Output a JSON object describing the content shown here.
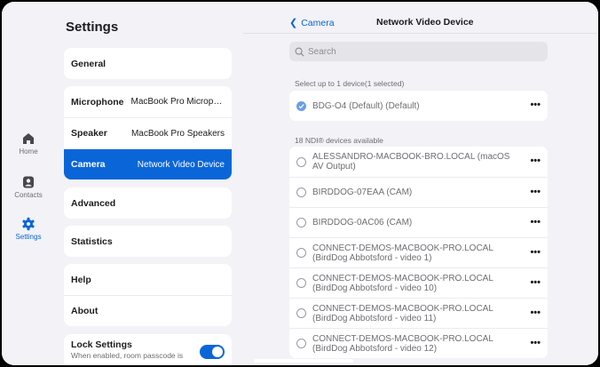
{
  "rail": {
    "items": [
      {
        "label": "Home",
        "icon": "home-icon"
      },
      {
        "label": "Contacts",
        "icon": "contacts-icon"
      },
      {
        "label": "Settings",
        "icon": "gear-icon"
      }
    ],
    "active_color": "#0a66d8"
  },
  "settings": {
    "title": "Settings",
    "general": "General",
    "microphone": {
      "label": "Microphone",
      "value": "MacBook Pro Micropho..."
    },
    "speaker": {
      "label": "Speaker",
      "value": "MacBook Pro Speakers"
    },
    "camera": {
      "label": "Camera",
      "value": "Network Video Device"
    },
    "advanced": "Advanced",
    "statistics": "Statistics",
    "help": "Help",
    "about": "About",
    "lock": {
      "label": "Lock Settings",
      "sub": "When enabled, room passcode is",
      "enabled": true
    }
  },
  "pane": {
    "back_label": "Camera",
    "title": "Network Video Device",
    "search_placeholder": "Search",
    "select_hint": "Select up to 1 device(1 selected)",
    "selected_device": "BDG-O4 (Default) (Default)",
    "available_label": "18 NDI® devices available",
    "more_label": "•••",
    "devices": [
      "ALESSANDRO-MACBOOK-BRO.LOCAL (macOS AV Output)",
      "BIRDDOG-07EAA (CAM)",
      "BIRDDOG-0AC06 (CAM)",
      "CONNECT-DEMOS-MACBOOK-PRO.LOCAL (BirdDog Abbotsford - video 1)",
      "CONNECT-DEMOS-MACBOOK-PRO.LOCAL (BirdDog Abbotsford - video 10)",
      "CONNECT-DEMOS-MACBOOK-PRO.LOCAL (BirdDog Abbotsford - video 11)",
      "CONNECT-DEMOS-MACBOOK-PRO.LOCAL (BirdDog Abbotsford - video 12)"
    ]
  }
}
